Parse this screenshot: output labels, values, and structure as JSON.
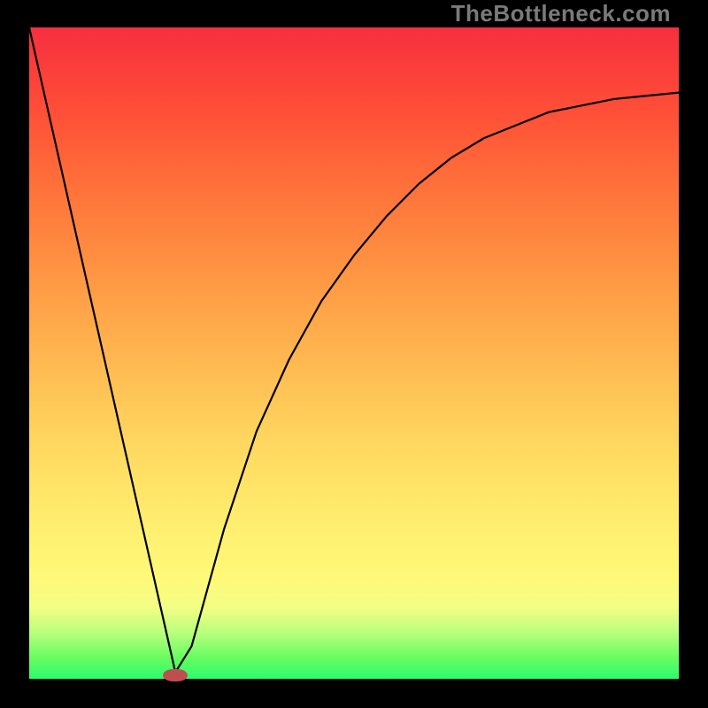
{
  "attribution": "TheBottleneck.com",
  "colors": {
    "curve": "#000000",
    "marker": "#bf4e50",
    "frame_bg": "#000000"
  },
  "chart_data": {
    "type": "line",
    "title": "",
    "xlabel": "",
    "ylabel": "",
    "x": [
      0.0,
      0.05,
      0.1,
      0.15,
      0.2,
      0.225,
      0.25,
      0.3,
      0.35,
      0.4,
      0.45,
      0.5,
      0.55,
      0.6,
      0.65,
      0.7,
      0.75,
      0.8,
      0.85,
      0.9,
      0.95,
      1.0
    ],
    "series": [
      {
        "name": "curve",
        "values": [
          1.0,
          0.78,
          0.56,
          0.34,
          0.12,
          0.01,
          0.05,
          0.23,
          0.38,
          0.49,
          0.58,
          0.65,
          0.71,
          0.76,
          0.8,
          0.83,
          0.85,
          0.87,
          0.88,
          0.89,
          0.895,
          0.9
        ]
      }
    ],
    "xlim": [
      0,
      1
    ],
    "ylim": [
      0,
      1
    ],
    "marker": {
      "x": 0.225,
      "y": 0.005
    }
  }
}
